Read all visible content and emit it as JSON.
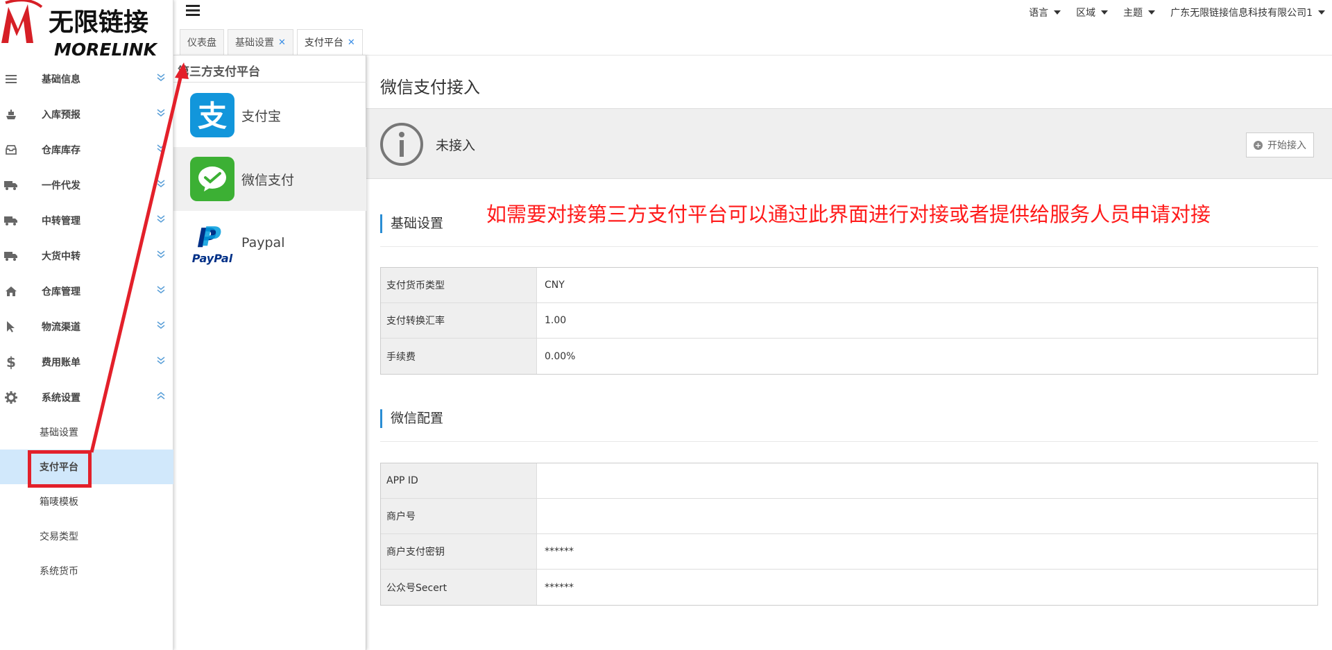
{
  "logo": {
    "brand_cn": "无限链接",
    "brand_en": "MORELINK"
  },
  "sidebar": {
    "items": [
      {
        "label": "基础信息",
        "icon": "list-icon"
      },
      {
        "label": "入库预报",
        "icon": "ship-icon"
      },
      {
        "label": "仓库库存",
        "icon": "inbox-icon"
      },
      {
        "label": "一件代发",
        "icon": "truck-icon"
      },
      {
        "label": "中转管理",
        "icon": "truck-icon"
      },
      {
        "label": "大货中转",
        "icon": "truck-icon"
      },
      {
        "label": "仓库管理",
        "icon": "home-icon"
      },
      {
        "label": "物流渠道",
        "icon": "pointer-icon"
      },
      {
        "label": "费用账单",
        "icon": "dollar-icon"
      },
      {
        "label": "系统设置",
        "icon": "gear-icon",
        "expanded": true
      }
    ],
    "subitems": [
      {
        "label": "基础设置"
      },
      {
        "label": "支付平台",
        "active": true
      },
      {
        "label": "箱唛模板"
      },
      {
        "label": "交易类型"
      },
      {
        "label": "系统货币"
      }
    ]
  },
  "topbar": {
    "language": "语言",
    "region": "区域",
    "theme": "主题",
    "company": "广东无限链接信息科技有限公司1"
  },
  "tabs": [
    {
      "label": "仪表盘",
      "closable": false
    },
    {
      "label": "基础设置",
      "closable": true
    },
    {
      "label": "支付平台",
      "closable": true,
      "active": true
    }
  ],
  "panel": {
    "title": "第三方支付平台",
    "platforms": [
      {
        "label": "支付宝",
        "icon": "alipay-icon",
        "color": "#1296db"
      },
      {
        "label": "微信支付",
        "icon": "wechat-pay-icon",
        "color": "#3cb034",
        "selected": true
      },
      {
        "label": "Paypal",
        "icon": "paypal-icon",
        "color": "#003087"
      }
    ]
  },
  "main": {
    "title": "微信支付接入",
    "status": "未接入",
    "start_button": "开始接入",
    "basic_section": "基础设置",
    "basic_rows": [
      {
        "key": "支付货币类型",
        "value": "CNY"
      },
      {
        "key": "支付转换汇率",
        "value": "1.00"
      },
      {
        "key": "手续费",
        "value": "0.00%"
      }
    ],
    "wechat_section": "微信配置",
    "wechat_rows": [
      {
        "key": "APP ID",
        "value": ""
      },
      {
        "key": "商户号",
        "value": ""
      },
      {
        "key": "商户支付密钥",
        "value": "******"
      },
      {
        "key": "公众号Secert",
        "value": "******"
      }
    ]
  },
  "annotation": {
    "note": "如需要对接第三方支付平台可以通过此界面进行对接或者提供给服务人员申请对接",
    "color": "#e3202a"
  }
}
